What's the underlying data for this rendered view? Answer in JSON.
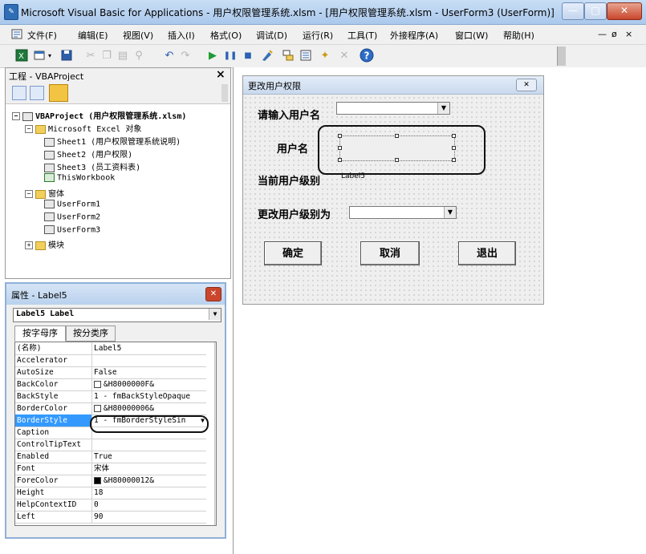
{
  "window": {
    "title": "Microsoft Visual Basic for Applications - 用户权限管理系统.xlsm - [用户权限管理系统.xlsm - UserForm3 (UserForm)]",
    "controls": [
      "—",
      "□",
      "✕"
    ]
  },
  "menu": {
    "items": [
      "文件(F)",
      "编辑(E)",
      "视图(V)",
      "插入(I)",
      "格式(O)",
      "调试(D)",
      "运行(R)",
      "工具(T)",
      "外接程序(A)",
      "窗口(W)",
      "帮助(H)"
    ],
    "mdi_controls": [
      "—",
      "ø",
      "×"
    ]
  },
  "project_panel": {
    "title": "工程 - VBAProject",
    "close": "×",
    "tree": {
      "root": "VBAProject (用户权限管理系统.xlsm)",
      "excel_objects_folder": "Microsoft Excel 对象",
      "sheets": [
        "Sheet1 (用户权限管理系统说明)",
        "Sheet2 (用户权限)",
        "Sheet3 (员工资料表)",
        "ThisWorkbook"
      ],
      "forms_folder": "窗体",
      "forms": [
        "UserForm1",
        "UserForm2",
        "UserForm3"
      ],
      "modules_folder": "模块"
    }
  },
  "properties_panel": {
    "title": "属性 - Label5",
    "object_combo": "Label5 Label",
    "tabs": [
      "按字母序",
      "按分类序"
    ],
    "rows": [
      {
        "name": "(名称)",
        "value": "Label5"
      },
      {
        "name": "Accelerator",
        "value": ""
      },
      {
        "name": "AutoSize",
        "value": "False"
      },
      {
        "name": "BackColor",
        "value": "&H8000000F&",
        "swatch": "#ffffff"
      },
      {
        "name": "BackStyle",
        "value": "1 - fmBackStyleOpaque"
      },
      {
        "name": "BorderColor",
        "value": "&H80000006&",
        "swatch": "#ffffff"
      },
      {
        "name": "BorderStyle",
        "value": "1 - fmBorderStyleSin",
        "selected": true
      },
      {
        "name": "Caption",
        "value": ""
      },
      {
        "name": "ControlTipText",
        "value": ""
      },
      {
        "name": "Enabled",
        "value": "True"
      },
      {
        "name": "Font",
        "value": "宋体"
      },
      {
        "name": "ForeColor",
        "value": "&H80000012&",
        "swatch": "#000000"
      },
      {
        "name": "Height",
        "value": "18"
      },
      {
        "name": "HelpContextID",
        "value": "0"
      },
      {
        "name": "Left",
        "value": "90"
      }
    ]
  },
  "userform": {
    "title": "更改用户权限",
    "close": "✕",
    "label_enter_user": "请输入用户名",
    "label_username": "用户名",
    "label_current_level": "当前用户级别",
    "label5_text": "Label5",
    "label_change_level": "更改用户级别为",
    "btn_ok": "确定",
    "btn_cancel": "取消",
    "btn_exit": "退出"
  },
  "colors": {
    "selection": "#3399ff",
    "form_bg": "#efefef",
    "titlebar": "#b9d1ee"
  }
}
